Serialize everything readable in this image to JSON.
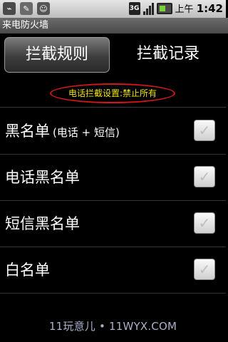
{
  "status_bar": {
    "icons": [
      "usb-icon",
      "edit-icon",
      "person-icon"
    ],
    "network": "3G",
    "time_prefix": "上午",
    "time": "1:42"
  },
  "app": {
    "title": "来电防火墙"
  },
  "tabs": [
    {
      "label": "拦截规则",
      "active": true
    },
    {
      "label": "拦截记录",
      "active": false
    }
  ],
  "banner": {
    "text": "电话拦截设置:禁止所有",
    "color": "#f2e300",
    "outline_color": "#d01818"
  },
  "list": [
    {
      "label": "黑名单",
      "sub": "(电话 + 短信)",
      "checked": true
    },
    {
      "label": "电话黑名单",
      "checked": true
    },
    {
      "label": "短信黑名单",
      "checked": true
    },
    {
      "label": "白名单",
      "checked": true
    }
  ],
  "watermark": "11玩意儿 • 11WYX.COM"
}
